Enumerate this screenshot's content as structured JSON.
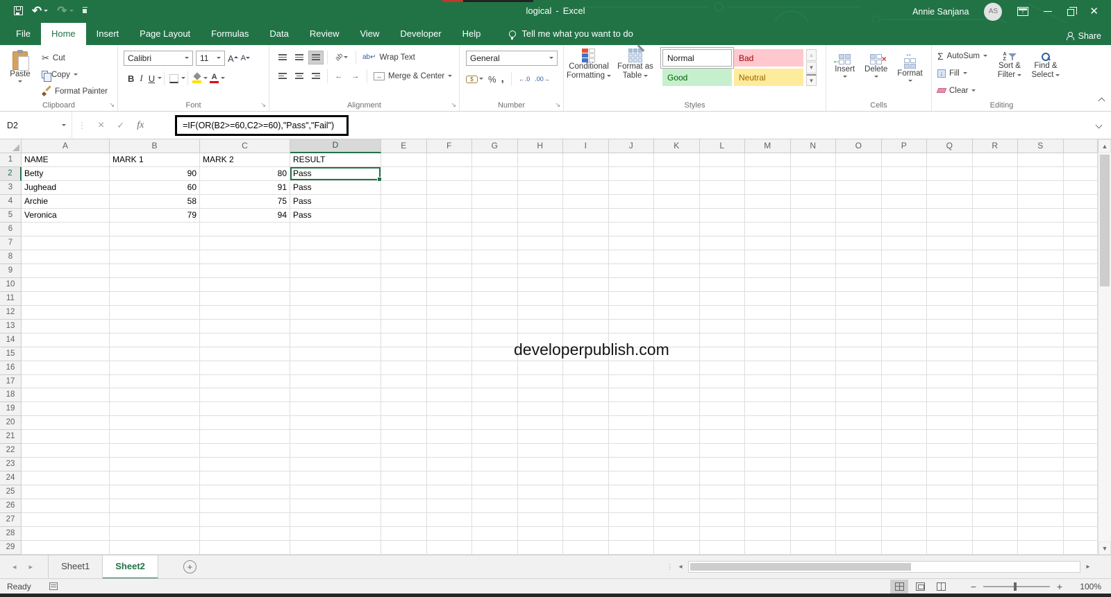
{
  "window": {
    "title_doc": "logical",
    "title_sep": "-",
    "title_app": "Excel",
    "user_name": "Annie Sanjana",
    "user_initials": "AS"
  },
  "ribbon": {
    "tabs": [
      {
        "label": "File",
        "active": false
      },
      {
        "label": "Home",
        "active": true
      },
      {
        "label": "Insert",
        "active": false
      },
      {
        "label": "Page Layout",
        "active": false
      },
      {
        "label": "Formulas",
        "active": false
      },
      {
        "label": "Data",
        "active": false
      },
      {
        "label": "Review",
        "active": false
      },
      {
        "label": "View",
        "active": false
      },
      {
        "label": "Developer",
        "active": false
      },
      {
        "label": "Help",
        "active": false
      }
    ],
    "tell_me": "Tell me what you want to do",
    "share": "Share",
    "groups": {
      "clipboard": {
        "label": "Clipboard",
        "paste": "Paste",
        "cut": "Cut",
        "copy": "Copy",
        "format_painter": "Format Painter"
      },
      "font": {
        "label": "Font",
        "family": "Calibri",
        "size": "11",
        "bold": "B",
        "italic": "I",
        "underline": "U"
      },
      "alignment": {
        "label": "Alignment",
        "wrap_text": "Wrap Text",
        "merge_center": "Merge & Center"
      },
      "number": {
        "label": "Number",
        "format": "General",
        "percent": "%",
        "comma": ","
      },
      "styles": {
        "label": "Styles",
        "conditional_1": "Conditional",
        "conditional_2": "Formatting",
        "format_table_1": "Format as",
        "format_table_2": "Table",
        "gallery": [
          {
            "name": "Normal",
            "bg": "#ffffff",
            "fg": "#1a1a1a",
            "border": "#ababab"
          },
          {
            "name": "Bad",
            "bg": "#ffc7ce",
            "fg": "#9c0006",
            "border": "#ffc7ce"
          },
          {
            "name": "Good",
            "bg": "#c6efce",
            "fg": "#006100",
            "border": "#c6efce"
          },
          {
            "name": "Neutral",
            "bg": "#ffeb9c",
            "fg": "#9c6500",
            "border": "#ffeb9c"
          }
        ]
      },
      "cells": {
        "label": "Cells",
        "insert": "Insert",
        "delete": "Delete",
        "format": "Format"
      },
      "editing": {
        "label": "Editing",
        "autosum": "AutoSum",
        "fill": "Fill",
        "clear": "Clear",
        "sort_1": "Sort &",
        "sort_2": "Filter",
        "find_1": "Find &",
        "find_2": "Select"
      }
    }
  },
  "formula_bar": {
    "name_box": "D2",
    "fx_label": "fx",
    "formula": "=IF(OR(B2>=60,C2>=60),\"Pass\",\"Fail\")"
  },
  "sheet": {
    "columns": [
      "A",
      "B",
      "C",
      "D",
      "E",
      "F",
      "G",
      "H",
      "I",
      "J",
      "K",
      "L",
      "M",
      "N",
      "O",
      "P",
      "Q",
      "R",
      "S"
    ],
    "row_count": 29,
    "selection": {
      "cell": "D2",
      "column": "D",
      "row": 2
    },
    "cells": {
      "A1": "NAME",
      "B1": "MARK 1",
      "C1": "MARK 2",
      "D1": "RESULT",
      "A2": "Betty",
      "B2": "90",
      "C2": "80",
      "D2": "Pass",
      "A3": "Jughead",
      "B3": "60",
      "C3": "91",
      "D3": "Pass",
      "A4": "Archie",
      "B4": "58",
      "C4": "75",
      "D4": "Pass",
      "A5": "Veronica",
      "B5": "79",
      "C5": "94",
      "D5": "Pass"
    },
    "table": {
      "headers": [
        "NAME",
        "MARK 1",
        "MARK 2",
        "RESULT"
      ],
      "rows": [
        [
          "Betty",
          "90",
          "80",
          "Pass"
        ],
        [
          "Jughead",
          "60",
          "91",
          "Pass"
        ],
        [
          "Archie",
          "58",
          "75",
          "Pass"
        ],
        [
          "Veronica",
          "79",
          "94",
          "Pass"
        ]
      ]
    },
    "watermark": "developerpublish.com"
  },
  "sheet_tabs": {
    "tabs": [
      {
        "label": "Sheet1",
        "active": false
      },
      {
        "label": "Sheet2",
        "active": true
      }
    ]
  },
  "status_bar": {
    "ready": "Ready",
    "zoom_level": "100%"
  },
  "glyphs": {
    "cut": "✂",
    "undo": "↶",
    "redo": "↷",
    "autosum": "Σ",
    "launcher": "↘",
    "cancel": "×",
    "enter": "✓",
    "orientation": "ab",
    "wrap": "ab↵",
    "merge": "↔",
    "currency": "$",
    "outdent": "←",
    "indent": "→",
    "inc_decimal": "←.0",
    "dec_decimal": ".00→",
    "plus": "+",
    "nav_left": "◂",
    "nav_right": "▸",
    "scroll_up": "▲",
    "scroll_down": "▼",
    "not_equal": "≠"
  },
  "colors": {
    "excel_green": "#217346",
    "bad_bg": "#ffc7ce",
    "bad_fg": "#9c0006",
    "good_bg": "#c6efce",
    "good_fg": "#006100",
    "neutral_bg": "#ffeb9c",
    "neutral_fg": "#9c6500"
  }
}
